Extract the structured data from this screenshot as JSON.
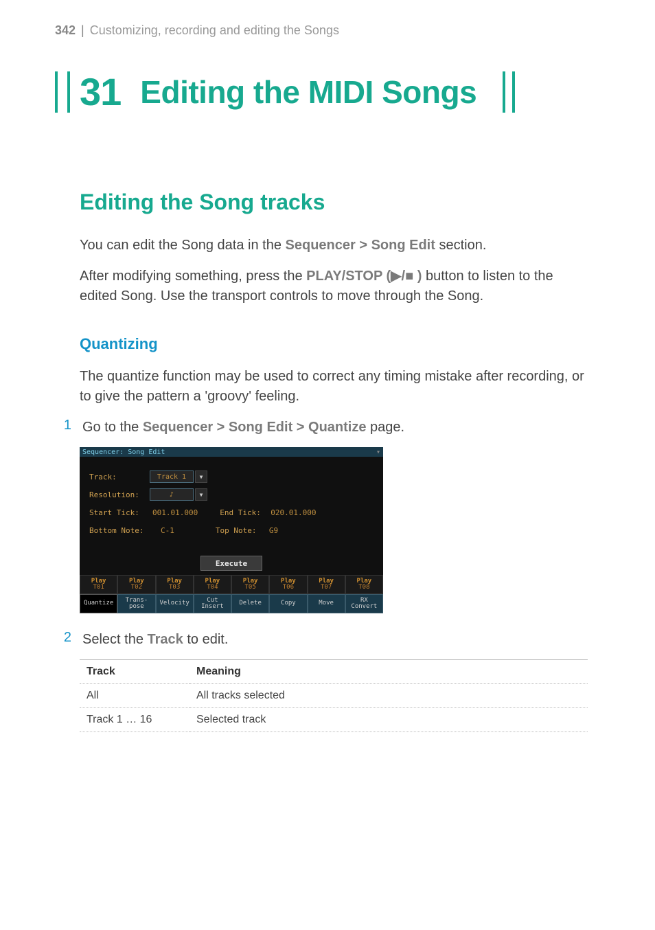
{
  "header": {
    "page_number": "342",
    "divider": "|",
    "section": "Customizing, recording and editing the Songs"
  },
  "chapter": {
    "number": "31",
    "title": "Editing the MIDI Songs"
  },
  "h2": "Editing the Song tracks",
  "intro1_pre": "You can edit the Song data in the ",
  "intro1_path": "Sequencer > Song Edit",
  "intro1_post": " section.",
  "intro2_pre": "After modifying something, press the ",
  "intro2_btn": "PLAY/STOP (",
  "intro2_icons": "▶/■",
  "intro2_btn_close": " )",
  "intro2_post": " button to listen to the edited Song. Use the transport controls to move through the Song.",
  "h3": "Quantizing",
  "quant_p": "The quantize function may be used to correct any timing mistake after recording, or to give the pattern a 'groovy' feeling.",
  "step1_n": "1",
  "step1_pre": "Go to the ",
  "step1_path": "Sequencer > Song Edit > Quantize",
  "step1_post": " page.",
  "screenshot": {
    "title": "Sequencer: Song Edit",
    "track_label": "Track:",
    "track_value": "Track 1",
    "resolution_label": "Resolution:",
    "resolution_value": "♪",
    "start_tick_label": "Start Tick:",
    "start_tick_value": "001.01.000",
    "end_tick_label": "End Tick:",
    "end_tick_value": "020.01.000",
    "bottom_note_label": "Bottom Note:",
    "bottom_note_value": "C-1",
    "top_note_label": "Top Note:",
    "top_note_value": "G9",
    "execute": "Execute",
    "play": "Play",
    "tracks": [
      "T01",
      "T02",
      "T03",
      "T04",
      "T05",
      "T06",
      "T07",
      "T08"
    ],
    "btabs": [
      "Quantize",
      "Trans-\npose",
      "Velocity",
      "Cut\nInsert",
      "Delete",
      "Copy",
      "Move",
      "RX\nConvert"
    ]
  },
  "step2_n": "2",
  "step2_pre": "Select the ",
  "step2_word": "Track",
  "step2_post": " to edit.",
  "table": {
    "h1": "Track",
    "h2": "Meaning",
    "r1c1": "All",
    "r1c2": "All tracks selected",
    "r2c1": "Track 1 … 16",
    "r2c2": "Selected track"
  }
}
